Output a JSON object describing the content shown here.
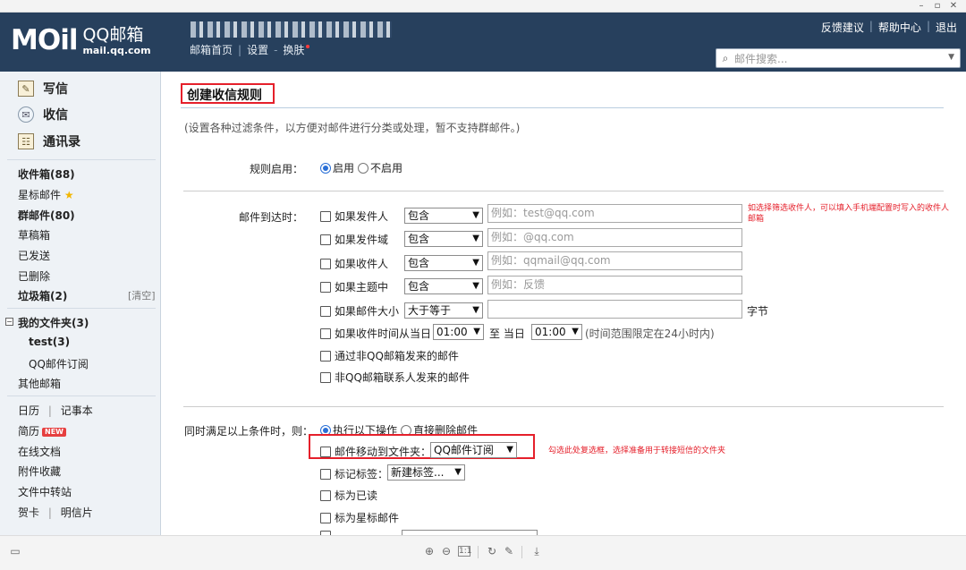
{
  "header": {
    "logo_mark": "MOil",
    "logo_title": "QQ邮箱",
    "logo_domain": "mail.qq.com",
    "nav": [
      "邮箱首页",
      "设置",
      "换肤"
    ],
    "links": [
      "反馈建议",
      "帮助中心",
      "退出"
    ],
    "search_placeholder": "邮件搜索..."
  },
  "sidebar": {
    "compose": "写信",
    "receive": "收信",
    "contacts": "通讯录",
    "inbox": "收件箱(88)",
    "starred": "星标邮件",
    "group": "群邮件(80)",
    "drafts": "草稿箱",
    "sent": "已发送",
    "deleted": "已删除",
    "spam": "垃圾箱(2)",
    "clear": "[清空]",
    "my_folders": "我的文件夹(3)",
    "folder_test": "test(3)",
    "folder_sub": "QQ邮件订阅",
    "other": "其他邮箱",
    "calendar": "日历",
    "notes": "记事本",
    "resume": "简历",
    "new_badge": "NEW",
    "docs": "在线文档",
    "attachments": "附件收藏",
    "transfer": "文件中转站",
    "card": "贺卡",
    "postcard": "明信片"
  },
  "main": {
    "title": "创建收信规则",
    "desc": "(设置各种过滤条件，以方便对邮件进行分类或处理，暂不支持群邮件。)",
    "rule_enable_label": "规则启用：",
    "enable_on": "启用",
    "enable_off": "不启用",
    "arrive_label": "邮件到达时：",
    "conditions": [
      {
        "label": "如果发件人",
        "op": "包含",
        "placeholder": "例如：test@qq.com"
      },
      {
        "label": "如果发件域",
        "op": "包含",
        "placeholder": "例如：@qq.com"
      },
      {
        "label": "如果收件人",
        "op": "包含",
        "placeholder": "例如：qqmail@qq.com"
      },
      {
        "label": "如果主题中",
        "op": "包含",
        "placeholder": "例如：反馈"
      },
      {
        "label": "如果邮件大小",
        "op": "大于等于",
        "placeholder": "",
        "unit": "字节"
      }
    ],
    "time_label": "如果收件时间从当日",
    "time_from": "01:00",
    "time_to_label": "至 当日",
    "time_to": "01:00",
    "time_note": "(时间范围限定在24小时内)",
    "nonqq_label": "通过非QQ邮箱发来的邮件",
    "noncontact_label": "非QQ邮箱联系人发来的邮件",
    "note1": "如选择筛选收件人，可以填入手机端配置时写入的收件人邮箱",
    "when_all_label": "同时满足以上条件时，则：",
    "action_do": "执行以下操作",
    "action_delete": "直接删除邮件",
    "move_label": "邮件移动到文件夹：",
    "move_folder": "QQ邮件订阅",
    "tag_label": "标记标签：",
    "tag_value": "新建标签...",
    "mark_read": "标为已读",
    "mark_star": "标为星标邮件",
    "note2": "勾选此处复选框，选择准备用于转接短信的文件夹"
  }
}
